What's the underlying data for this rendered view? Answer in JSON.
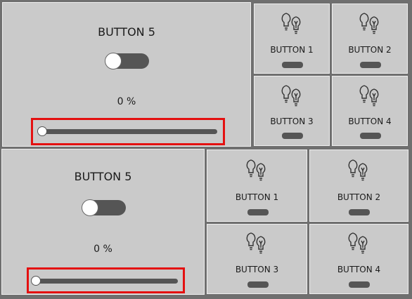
{
  "groups": [
    {
      "title": "BUTTON 5",
      "percent": "0 %",
      "toggle_state": "off",
      "slider_value": 0,
      "buttons": [
        {
          "label": "BUTTON 1",
          "icon": "light-bulbs-icon"
        },
        {
          "label": "BUTTON 2",
          "icon": "light-bulbs-icon"
        },
        {
          "label": "BUTTON 3",
          "icon": "light-bulbs-icon"
        },
        {
          "label": "BUTTON 4",
          "icon": "light-bulbs-icon"
        }
      ]
    },
    {
      "title": "BUTTON 5",
      "percent": "0 %",
      "toggle_state": "off",
      "slider_value": 0,
      "buttons": [
        {
          "label": "BUTTON 1",
          "icon": "light-bulbs-icon"
        },
        {
          "label": "BUTTON 2",
          "icon": "light-bulbs-icon"
        },
        {
          "label": "BUTTON 3",
          "icon": "light-bulbs-icon"
        },
        {
          "label": "BUTTON 4",
          "icon": "light-bulbs-icon"
        }
      ]
    }
  ],
  "colors": {
    "panel": "#cacaca",
    "control": "#555555",
    "highlight": "#e41010"
  }
}
